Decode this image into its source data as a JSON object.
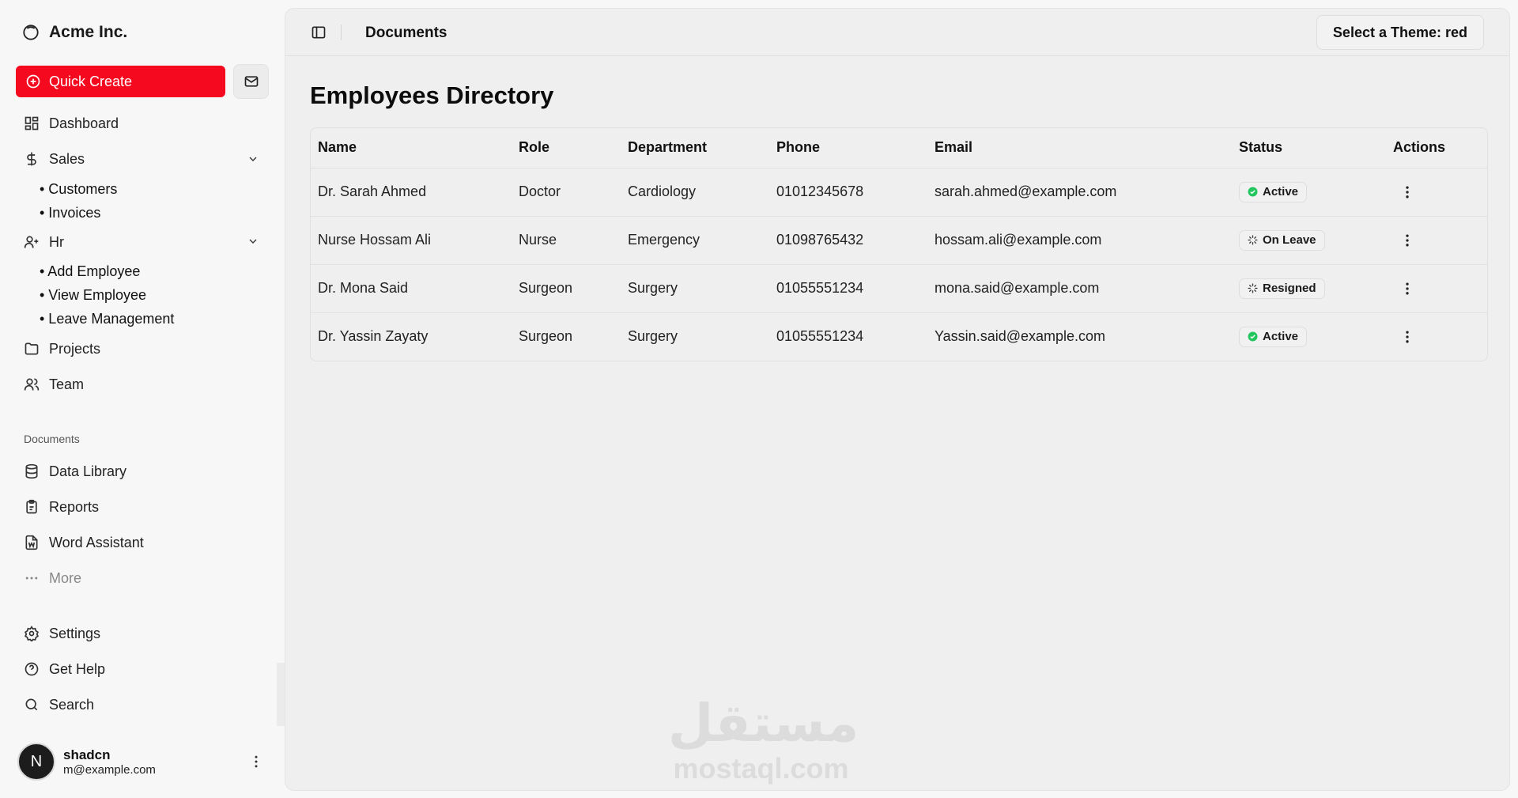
{
  "sidebar": {
    "brand": "Acme Inc.",
    "quick_create": "Quick Create",
    "nav": [
      {
        "label": "Dashboard"
      },
      {
        "label": "Sales"
      },
      {
        "label": "Hr"
      },
      {
        "label": "Projects"
      },
      {
        "label": "Team"
      }
    ],
    "sales_sub": [
      "• Customers",
      "• Invoices"
    ],
    "hr_sub": [
      "• Add Employee",
      "• View Employee",
      "• Leave Management"
    ],
    "documents_label": "Documents",
    "documents": [
      {
        "label": "Data Library"
      },
      {
        "label": "Reports"
      },
      {
        "label": "Word Assistant"
      },
      {
        "label": "More"
      }
    ],
    "footer_nav": [
      {
        "label": "Settings"
      },
      {
        "label": "Get Help"
      },
      {
        "label": "Search"
      }
    ],
    "user": {
      "initial": "N",
      "name": "shadcn",
      "email": "m@example.com"
    }
  },
  "header": {
    "title": "Documents",
    "theme_button": "Select a Theme: red"
  },
  "main": {
    "title": "Employees Directory",
    "columns": [
      "Name",
      "Role",
      "Department",
      "Phone",
      "Email",
      "Status",
      "Actions"
    ],
    "rows": [
      {
        "name": "Dr. Sarah Ahmed",
        "role": "Doctor",
        "department": "Cardiology",
        "phone": "01012345678",
        "email": "sarah.ahmed@example.com",
        "status": "Active"
      },
      {
        "name": "Nurse Hossam Ali",
        "role": "Nurse",
        "department": "Emergency",
        "phone": "01098765432",
        "email": "hossam.ali@example.com",
        "status": "On Leave"
      },
      {
        "name": "Dr. Mona Said",
        "role": "Surgeon",
        "department": "Surgery",
        "phone": "01055551234",
        "email": "mona.said@example.com",
        "status": "Resigned"
      },
      {
        "name": "Dr. Yassin Zayaty",
        "role": "Surgeon",
        "department": "Surgery",
        "phone": "01055551234",
        "email": "Yassin.said@example.com",
        "status": "Active"
      }
    ]
  },
  "watermark": {
    "arabic": "مستقل",
    "latin": "mostaql.com"
  },
  "colors": {
    "accent": "#f4091f",
    "active": "#22c55e"
  },
  "icons": [
    "brand-ring-icon",
    "plus-circle-icon",
    "mail-icon",
    "dashboard-icon",
    "dollar-icon",
    "chevron-down-icon",
    "user-plus-icon",
    "folder-icon",
    "users-icon",
    "database-icon",
    "clipboard-icon",
    "file-word-icon",
    "ellipsis-icon",
    "gear-icon",
    "help-circle-icon",
    "search-icon",
    "sidebar-toggle-icon",
    "check-circle-icon",
    "loader-icon",
    "kebab-icon"
  ]
}
